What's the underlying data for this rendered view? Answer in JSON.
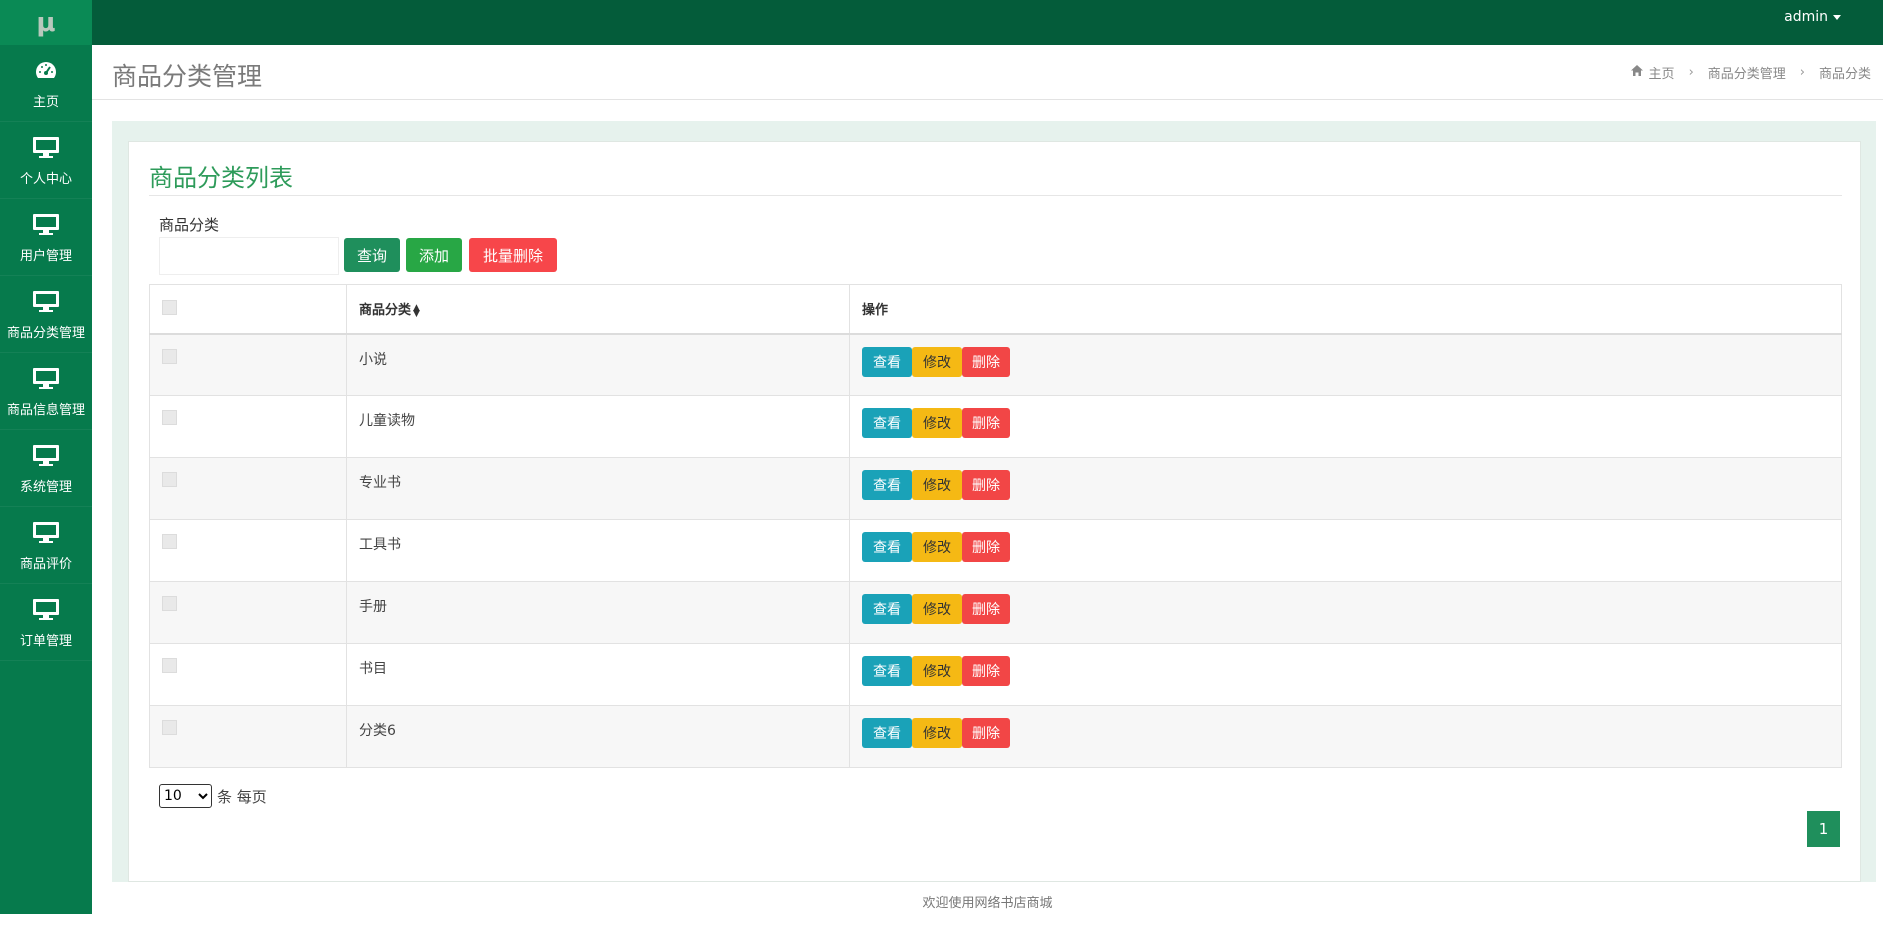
{
  "sidebar": {
    "logo": "μ",
    "items": [
      {
        "label": "主页",
        "icon": "dashboard-icon"
      },
      {
        "label": "个人中心",
        "icon": "monitor-icon"
      },
      {
        "label": "用户管理",
        "icon": "monitor-icon"
      },
      {
        "label": "商品分类管理",
        "icon": "monitor-icon"
      },
      {
        "label": "商品信息管理",
        "icon": "monitor-icon"
      },
      {
        "label": "系统管理",
        "icon": "monitor-icon"
      },
      {
        "label": "商品评价",
        "icon": "monitor-icon"
      },
      {
        "label": "订单管理",
        "icon": "monitor-icon"
      }
    ]
  },
  "topbar": {
    "user": "admin"
  },
  "header": {
    "title": "商品分类管理",
    "breadcrumb": [
      "主页",
      "商品分类管理",
      "商品分类"
    ]
  },
  "card": {
    "title": "商品分类列表",
    "filter_label": "商品分类",
    "filter_value": "",
    "buttons": {
      "query": "查询",
      "add": "添加",
      "bulk_delete": "批量删除"
    }
  },
  "table": {
    "headers": {
      "name": "商品分类",
      "actions": "操作"
    },
    "action_labels": {
      "view": "查看",
      "edit": "修改",
      "delete": "删除"
    },
    "rows": [
      "小说",
      "儿童读物",
      "专业书",
      "工具书",
      "手册",
      "书目",
      "分类6"
    ]
  },
  "pagination": {
    "page_size": "10",
    "page_size_suffix": "条 每页",
    "current_page": "1"
  },
  "footer": "欢迎使用网络书店商城",
  "colors": {
    "sidebar": "#067a4c",
    "topbar": "#045c3a",
    "accent": "#2e9b5a"
  }
}
